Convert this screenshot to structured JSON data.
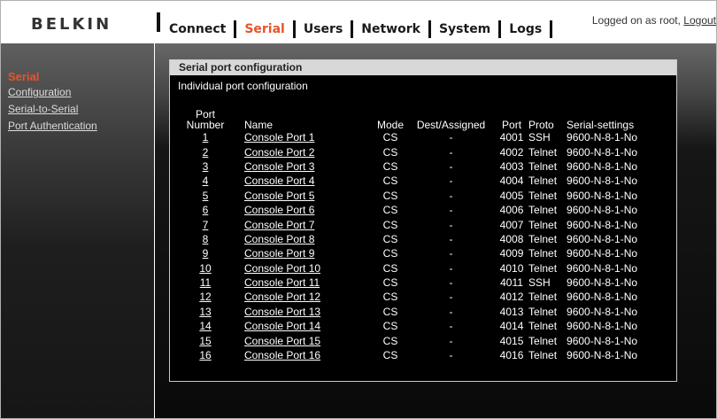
{
  "header": {
    "logo": "BELKIN",
    "nav": [
      {
        "label": "Connect",
        "active": false
      },
      {
        "label": "Serial",
        "active": true
      },
      {
        "label": "Users",
        "active": false
      },
      {
        "label": "Network",
        "active": false
      },
      {
        "label": "System",
        "active": false
      },
      {
        "label": "Logs",
        "active": false
      }
    ],
    "login_text": "Logged on as root,",
    "logout_label": "Logout"
  },
  "sidebar": {
    "title": "Serial",
    "items": [
      {
        "label": "Configuration"
      },
      {
        "label": "Serial-to-Serial"
      },
      {
        "label": "Port Authentication"
      }
    ]
  },
  "panel": {
    "title": "Serial port configuration",
    "subtitle": "Individual port configuration",
    "columns": [
      "Port Number",
      "Name",
      "Mode",
      "Dest/Assigned",
      "Port",
      "Proto",
      "Serial-settings"
    ],
    "rows": [
      {
        "num": "1",
        "name": "Console Port 1",
        "mode": "CS",
        "dest": "-",
        "port": "4001",
        "proto": "SSH",
        "settings": "9600-N-8-1-No"
      },
      {
        "num": "2",
        "name": "Console Port 2",
        "mode": "CS",
        "dest": "-",
        "port": "4002",
        "proto": "Telnet",
        "settings": "9600-N-8-1-No"
      },
      {
        "num": "3",
        "name": "Console Port 3",
        "mode": "CS",
        "dest": "-",
        "port": "4003",
        "proto": "Telnet",
        "settings": "9600-N-8-1-No"
      },
      {
        "num": "4",
        "name": "Console Port 4",
        "mode": "CS",
        "dest": "-",
        "port": "4004",
        "proto": "Telnet",
        "settings": "9600-N-8-1-No"
      },
      {
        "num": "5",
        "name": "Console Port 5",
        "mode": "CS",
        "dest": "-",
        "port": "4005",
        "proto": "Telnet",
        "settings": "9600-N-8-1-No"
      },
      {
        "num": "6",
        "name": "Console Port 6",
        "mode": "CS",
        "dest": "-",
        "port": "4006",
        "proto": "Telnet",
        "settings": "9600-N-8-1-No"
      },
      {
        "num": "7",
        "name": "Console Port 7",
        "mode": "CS",
        "dest": "-",
        "port": "4007",
        "proto": "Telnet",
        "settings": "9600-N-8-1-No"
      },
      {
        "num": "8",
        "name": "Console Port 8",
        "mode": "CS",
        "dest": "-",
        "port": "4008",
        "proto": "Telnet",
        "settings": "9600-N-8-1-No"
      },
      {
        "num": "9",
        "name": "Console Port 9",
        "mode": "CS",
        "dest": "-",
        "port": "4009",
        "proto": "Telnet",
        "settings": "9600-N-8-1-No"
      },
      {
        "num": "10",
        "name": "Console Port 10",
        "mode": "CS",
        "dest": "-",
        "port": "4010",
        "proto": "Telnet",
        "settings": "9600-N-8-1-No"
      },
      {
        "num": "11",
        "name": "Console Port 11",
        "mode": "CS",
        "dest": "-",
        "port": "4011",
        "proto": "SSH",
        "settings": "9600-N-8-1-No"
      },
      {
        "num": "12",
        "name": "Console Port 12",
        "mode": "CS",
        "dest": "-",
        "port": "4012",
        "proto": "Telnet",
        "settings": "9600-N-8-1-No"
      },
      {
        "num": "13",
        "name": "Console Port 13",
        "mode": "CS",
        "dest": "-",
        "port": "4013",
        "proto": "Telnet",
        "settings": "9600-N-8-1-No"
      },
      {
        "num": "14",
        "name": "Console Port 14",
        "mode": "CS",
        "dest": "-",
        "port": "4014",
        "proto": "Telnet",
        "settings": "9600-N-8-1-No"
      },
      {
        "num": "15",
        "name": "Console Port 15",
        "mode": "CS",
        "dest": "-",
        "port": "4015",
        "proto": "Telnet",
        "settings": "9600-N-8-1-No"
      },
      {
        "num": "16",
        "name": "Console Port 16",
        "mode": "CS",
        "dest": "-",
        "port": "4016",
        "proto": "Telnet",
        "settings": "9600-N-8-1-No"
      }
    ]
  },
  "colors": {
    "accent": "#e8542a",
    "panel_header": "#d8d8d8",
    "background": "#000000"
  }
}
